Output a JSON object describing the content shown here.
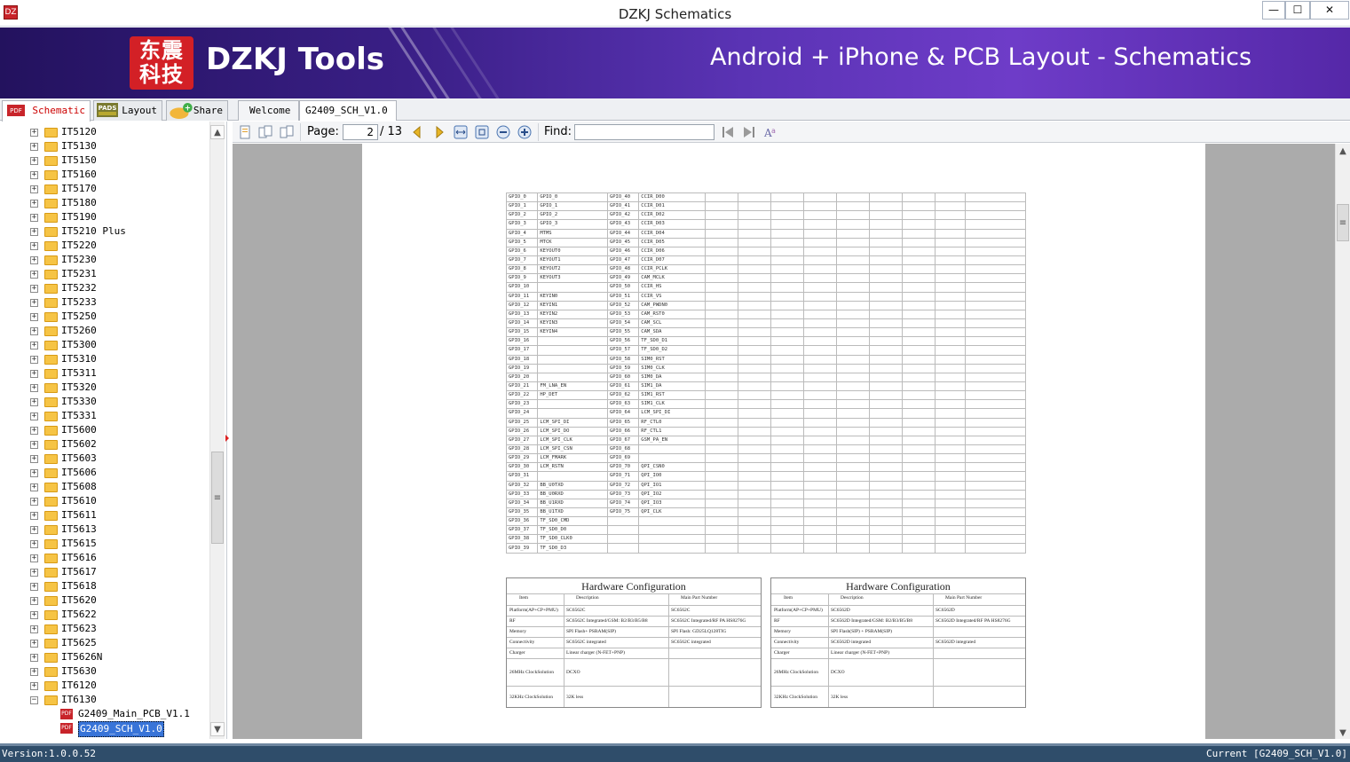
{
  "window": {
    "title": "DZKJ Schematics",
    "icon_text": "DZ",
    "minimize_label": "—",
    "maximize_label": "☐",
    "close_label": "✕"
  },
  "banner": {
    "logo_glyphs": [
      "东震",
      "科技"
    ],
    "brand": "DZKJ Tools",
    "tagline": "Android + iPhone & PCB Layout - Schematics"
  },
  "main_tabs": [
    {
      "label": "Schematic",
      "icon": "pdf-icon",
      "active": true
    },
    {
      "label": "Layout",
      "icon": "pads-icon",
      "active": false
    },
    {
      "label": "Share",
      "icon": "cloud-share-icon",
      "active": false
    }
  ],
  "doc_tabs": [
    {
      "label": "Welcome",
      "active": false
    },
    {
      "label": "G2409_SCH_V1.0",
      "active": true,
      "close": "×"
    }
  ],
  "tree": {
    "folders": [
      "IT5120",
      "IT5130",
      "IT5150",
      "IT5160",
      "IT5170",
      "IT5180",
      "IT5190",
      "IT5210 Plus",
      "IT5220",
      "IT5230",
      "IT5231",
      "IT5232",
      "IT5233",
      "IT5250",
      "IT5260",
      "IT5300",
      "IT5310",
      "IT5311",
      "IT5320",
      "IT5330",
      "IT5331",
      "IT5600",
      "IT5602",
      "IT5603",
      "IT5606",
      "IT5608",
      "IT5610",
      "IT5611",
      "IT5613",
      "IT5615",
      "IT5616",
      "IT5617",
      "IT5618",
      "IT5620",
      "IT5622",
      "IT5623",
      "IT5625",
      "IT5626N",
      "IT5630",
      "IT6120",
      "IT6130"
    ],
    "expanded_folder": "IT6130",
    "files": [
      "G2409_Main_PCB_V1.1",
      "G2409_SCH_V1.0"
    ],
    "selected_file": "G2409_SCH_V1.0"
  },
  "toolbar": {
    "page_label": "Page:",
    "page_current": "2",
    "page_total": "/ 13",
    "find_label": "Find:",
    "find_value": ""
  },
  "gpio_table": [
    [
      "GPIO_0",
      "GPIO_0",
      "GPIO_40",
      "CCIR_D00"
    ],
    [
      "GPIO_1",
      "GPIO_1",
      "GPIO_41",
      "CCIR_D01"
    ],
    [
      "GPIO_2",
      "GPIO_2",
      "GPIO_42",
      "CCIR_D02"
    ],
    [
      "GPIO_3",
      "GPIO_3",
      "GPIO_43",
      "CCIR_D03"
    ],
    [
      "GPIO_4",
      "MTMS",
      "GPIO_44",
      "CCIR_D04"
    ],
    [
      "GPIO_5",
      "MTCK",
      "GPIO_45",
      "CCIR_D05"
    ],
    [
      "GPIO_6",
      "KEYOUT0",
      "GPIO_46",
      "CCIR_D06"
    ],
    [
      "GPIO_7",
      "KEYOUT1",
      "GPIO_47",
      "CCIR_D07"
    ],
    [
      "GPIO_8",
      "KEYOUT2",
      "GPIO_48",
      "CCIR_PCLK"
    ],
    [
      "GPIO_9",
      "KEYOUT3",
      "GPIO_49",
      "CAM_MCLK"
    ],
    [
      "GPIO_10",
      "",
      "GPIO_50",
      "CCIR_HS"
    ],
    [
      "GPIO_11",
      "KEYIN0",
      "GPIO_51",
      "CCIR_VS"
    ],
    [
      "GPIO_12",
      "KEYIN1",
      "GPIO_52",
      "CAM_PWDN0"
    ],
    [
      "GPIO_13",
      "KEYIN2",
      "GPIO_53",
      "CAM_RST0"
    ],
    [
      "GPIO_14",
      "KEYIN3",
      "GPIO_54",
      "CAM_SCL"
    ],
    [
      "GPIO_15",
      "KEYIN4",
      "GPIO_55",
      "CAM_SDA"
    ],
    [
      "GPIO_16",
      "",
      "GPIO_56",
      "TF_SD0_D1"
    ],
    [
      "GPIO_17",
      "",
      "GPIO_57",
      "TF_SD0_D2"
    ],
    [
      "GPIO_18",
      "",
      "GPIO_58",
      "SIM0_RST"
    ],
    [
      "GPIO_19",
      "",
      "GPIO_59",
      "SIM0_CLK"
    ],
    [
      "GPIO_20",
      "",
      "GPIO_60",
      "SIM0_DA"
    ],
    [
      "GPIO_21",
      "FM_LNA_EN",
      "GPIO_61",
      "SIM1_DA"
    ],
    [
      "GPIO_22",
      "HP_DET",
      "GPIO_62",
      "SIM1_RST"
    ],
    [
      "GPIO_23",
      "",
      "GPIO_63",
      "SIM1_CLK"
    ],
    [
      "GPIO_24",
      "",
      "GPIO_64",
      "LCM_SPI_DI"
    ],
    [
      "GPIO_25",
      "LCM_SPI_DI",
      "GPIO_65",
      "RF_CTL0"
    ],
    [
      "GPIO_26",
      "LCM_SPI_DO",
      "GPIO_66",
      "RF_CTL1"
    ],
    [
      "GPIO_27",
      "LCM_SPI_CLK",
      "GPIO_67",
      "GSM_PA_EN"
    ],
    [
      "GPIO_28",
      "LCM_SPI_CSN",
      "GPIO_68",
      ""
    ],
    [
      "GPIO_29",
      "LCM_FMARK",
      "GPIO_69",
      ""
    ],
    [
      "GPIO_30",
      "LCM_RSTN",
      "GPIO_70",
      "QPI_CSN0"
    ],
    [
      "GPIO_31",
      "",
      "GPIO_71",
      "QPI_IO0"
    ],
    [
      "GPIO_32",
      "BB_U0TXD",
      "GPIO_72",
      "QPI_IO1"
    ],
    [
      "GPIO_33",
      "BB_U0RXD",
      "GPIO_73",
      "QPI_IO2"
    ],
    [
      "GPIO_34",
      "BB_U1RXD",
      "GPIO_74",
      "QPI_IO3"
    ],
    [
      "GPIO_35",
      "BB_U1TXD",
      "GPIO_75",
      "QPI_CLK"
    ],
    [
      "GPIO_36",
      "TF_SD0_CMD",
      "",
      ""
    ],
    [
      "GPIO_37",
      "TF_SD0_D0",
      "",
      ""
    ],
    [
      "GPIO_38",
      "TF_SD0_CLK0",
      "",
      ""
    ],
    [
      "GPIO_39",
      "TF_SD0_D3",
      "",
      ""
    ]
  ],
  "hw_tables": [
    {
      "title": "Hardware Configuration",
      "headers": [
        "Item",
        "Description",
        "Main Part Number"
      ],
      "rows": [
        [
          "Platform(AP+CP+PMU)",
          "SC6562C",
          "SC6562C"
        ],
        [
          "RF",
          "SC6562C Integrated/GSM: B2/B3/B5/B8",
          "SC6562C Integrated/RF PA HS8276G"
        ],
        [
          "Memory",
          "SPI Flash+ PSRAM(SIP)",
          "SPI Flash: GD25LQ128TIG"
        ],
        [
          "Connectivity",
          "SC6562C integrated",
          "SC6562C integrated"
        ],
        [
          "Charger",
          "Linear charger (N-FET+PNP)",
          ""
        ],
        [
          "26MHz ClockSolution",
          "DCXO",
          ""
        ],
        [
          "32KHz ClockSolution",
          "32K less",
          ""
        ]
      ]
    },
    {
      "title": "Hardware Configuration",
      "headers": [
        "Item",
        "Description",
        "Main Part Number"
      ],
      "rows": [
        [
          "Platform(AP+CP+PMU)",
          "SC6562D",
          "SC6562D"
        ],
        [
          "RF",
          "SC6562D Integrated/GSM: B2/B3/B5/B8",
          "SC6562D Integrated/RF PA HS8276G"
        ],
        [
          "Memory",
          "SPI Flash(SIP) + PSRAM(SIP)",
          ""
        ],
        [
          "Connectivity",
          "SC6562D integrated",
          "SC6562D integrated"
        ],
        [
          "Charger",
          "Linear charger (N-FET+PNP)",
          ""
        ],
        [
          "26MHz ClockSolution",
          "DCXO",
          ""
        ],
        [
          "32KHz ClockSolution",
          "32K less",
          ""
        ]
      ]
    }
  ],
  "status": {
    "version": "Version:1.0.0.52",
    "current": "Current [G2409_SCH_V1.0]"
  },
  "colors": {
    "banner": "#3a1f86",
    "statusbar": "#2f4d6a",
    "selection": "#3874d8"
  }
}
